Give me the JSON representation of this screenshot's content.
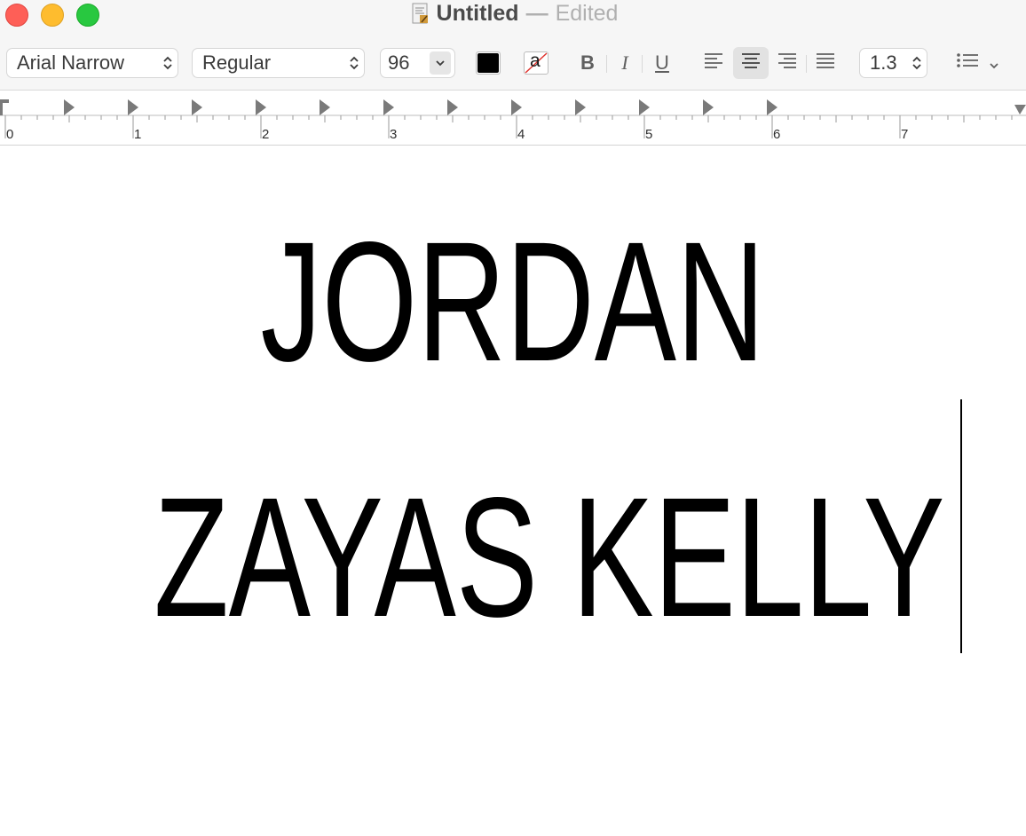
{
  "window": {
    "title": "Untitled",
    "separator": "—",
    "status": "Edited",
    "icons": {
      "close": "close-traffic-light",
      "minimize": "minimize-traffic-light",
      "zoom": "zoom-traffic-light",
      "document": "textedit-document-icon"
    }
  },
  "toolbar": {
    "font_family": "Arial Narrow",
    "font_style": "Regular",
    "font_size": "96",
    "text_color": "#000000",
    "background_color_label": "a",
    "bold_label": "B",
    "italic_label": "I",
    "underline_label": "U",
    "line_spacing": "1.3",
    "alignment_selected": "center",
    "icons": {
      "updown": "chevron-updown-icon",
      "dropdown": "chevron-down-icon",
      "align_left": "align-left-icon",
      "align_center": "align-center-icon",
      "align_right": "align-right-icon",
      "justify": "justify-icon",
      "list": "bullet-list-icon"
    }
  },
  "ruler": {
    "labels": [
      "0",
      "1",
      "2",
      "3",
      "4",
      "5",
      "6",
      "7"
    ]
  },
  "document": {
    "lines": [
      "JORDAN",
      "ZAYAS KELLY"
    ]
  }
}
